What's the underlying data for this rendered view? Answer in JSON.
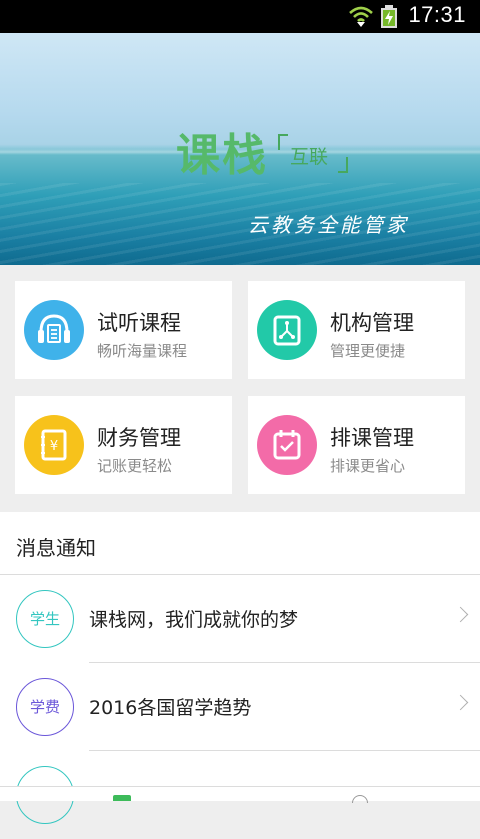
{
  "status_bar": {
    "time": "17:31"
  },
  "banner": {
    "brand": "课栈",
    "sub": "互联",
    "slogan": "云教务全能管家"
  },
  "features": [
    {
      "title": "试听课程",
      "desc": "畅听海量课程",
      "icon": "headphones-icon",
      "color": "#3fb2ea"
    },
    {
      "title": "机构管理",
      "desc": "管理更便捷",
      "icon": "org-chart-icon",
      "color": "#22c9a8"
    },
    {
      "title": "财务管理",
      "desc": "记账更轻松",
      "icon": "ledger-yen-icon",
      "color": "#f7c21b"
    },
    {
      "title": "排课管理",
      "desc": "排课更省心",
      "icon": "calendar-check-icon",
      "color": "#f36ba8"
    }
  ],
  "notices": {
    "title": "消息通知",
    "items": [
      {
        "badge": "学生",
        "text": "课栈网，我们成就你的梦",
        "color": "#33c6c0"
      },
      {
        "badge": "学费",
        "text": "2016各国留学趋势",
        "color": "#6b57d9"
      },
      {
        "badge": "",
        "text": "",
        "color": "#33c6c0"
      }
    ]
  }
}
